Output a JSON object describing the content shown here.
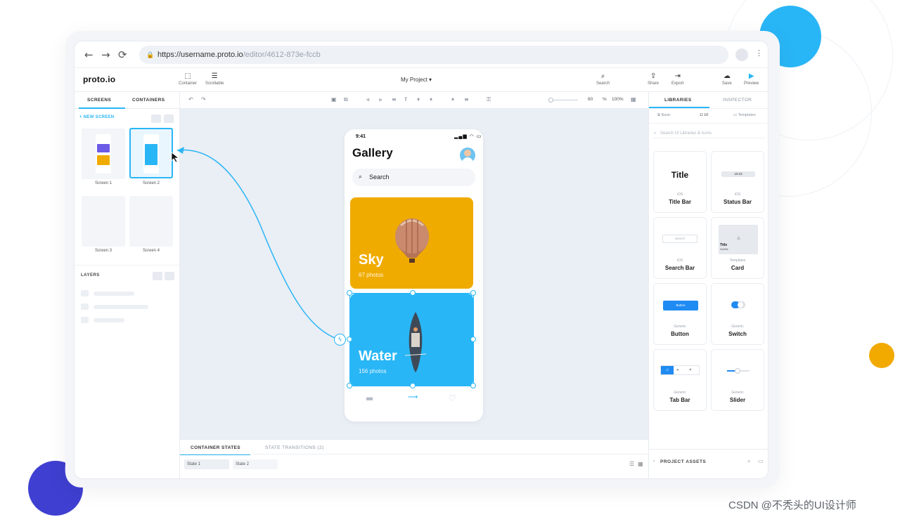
{
  "browser": {
    "url_host": "https://username.proto.io",
    "url_path": "/editor/4612-873e-fccb",
    "nav": {
      "back": "←",
      "forward": "→",
      "reload": "⟳",
      "menu": "⋮"
    }
  },
  "app": {
    "logo": "proto.io",
    "project_name": "My Project ▾",
    "toolbar_left": [
      {
        "label": "Container",
        "icon": "container-icon",
        "glyph": "⬚"
      },
      {
        "label": "Scrollable",
        "icon": "scrollable-icon",
        "glyph": "☰"
      }
    ],
    "toolbar_right": [
      {
        "label": "Search",
        "icon": "search-icon",
        "glyph": "⌕"
      },
      {
        "label": "Share",
        "icon": "share-icon",
        "glyph": "⇪"
      },
      {
        "label": "Export",
        "icon": "export-icon",
        "glyph": "⇥"
      },
      {
        "label": "Save",
        "icon": "save-icon",
        "glyph": "☁"
      },
      {
        "label": "Preview",
        "icon": "preview-icon",
        "glyph": "▶"
      }
    ]
  },
  "left_panel": {
    "tabs": [
      "SCREENS",
      "CONTAINERS"
    ],
    "new_screen": "+ NEW SCREEN",
    "screens": [
      "Screen 1",
      "Screen 2",
      "Screen 3",
      "Screen 4"
    ],
    "layers_title": "LAYERS"
  },
  "canvas_toolbar": {
    "undo": "↶",
    "redo": "↷",
    "zoom_value": "60",
    "zoom_pct": "%",
    "zoom_full": "100%"
  },
  "phone": {
    "time": "9:41",
    "status_icons": "▂▄▆ ◠ ▭",
    "title": "Gallery",
    "search_placeholder": "Search",
    "tiles": [
      {
        "title": "Sky",
        "subtitle": "67 photos",
        "color": "#f0ab00"
      },
      {
        "title": "Water",
        "subtitle": "156 photos",
        "color": "#29b6f6"
      }
    ],
    "tabbar": [
      "folder-icon",
      "swipe-icon",
      "heart-icon"
    ]
  },
  "bottom_panel": {
    "tabs": [
      "CONTAINER STATES",
      "STATE TRANSITIONS (2)"
    ],
    "states": [
      "State 1",
      "State 2"
    ]
  },
  "right_panel": {
    "tabs": [
      "LIBRARIES",
      "INSPECTOR"
    ],
    "subtabs": [
      "Basic",
      "UI",
      "Templates"
    ],
    "search_placeholder": "Search UI Libraries & Icons",
    "cards": [
      {
        "cap": "iOS",
        "name": "Title Bar",
        "preview": "Title"
      },
      {
        "cap": "iOS",
        "name": "Status Bar",
        "preview": "10:23"
      },
      {
        "cap": "iOS",
        "name": "Search Bar",
        "preview": "Search"
      },
      {
        "cap": "Templates",
        "name": "Card",
        "preview": "Title",
        "preview_sub": "Subtitle"
      },
      {
        "cap": "Generic",
        "name": "Button",
        "preview": "Button"
      },
      {
        "cap": "Generic",
        "name": "Switch",
        "preview": ""
      },
      {
        "cap": "Generic",
        "name": "Tab Bar",
        "preview": ""
      },
      {
        "cap": "Generic",
        "name": "Slider",
        "preview": ""
      }
    ],
    "project_assets": "PROJECT ASSETS"
  },
  "watermark": "CSDN @不秃头的UI设计师",
  "colors": {
    "accent": "#29b6f6",
    "sky": "#f0ab00",
    "water": "#29b6f6",
    "indigo": "#3f3fd1"
  }
}
